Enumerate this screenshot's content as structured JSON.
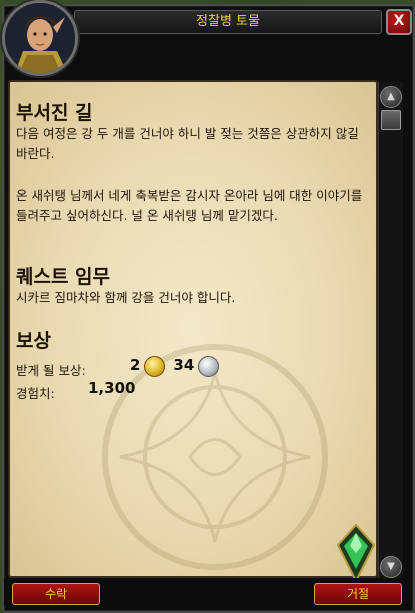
{
  "window": {
    "title": "정찰병 토물",
    "close_label": "X"
  },
  "quest": {
    "title": "부서진 길",
    "description_1": "다음 여정은 강 두 개를 건너야 하니 발 젖는 것쯤은 상관하지 않길 바란다.",
    "description_2": "온 새쉬탱 님께서 네게 축복받은 감시자 온아라 님에 대한 이야기를 들려주고 싶어하신다. 널 온 새쉬탱 님께 맡기겠다."
  },
  "objectives": {
    "heading": "퀘스트 임무",
    "text": "시카르 짐마차와 함께 강을 건너야 합니다."
  },
  "rewards": {
    "heading": "보상",
    "receive_label": "받게 될 보상:",
    "gold": "2",
    "silver": "34",
    "xp_label": "경험치:",
    "xp_value": "1,300"
  },
  "buttons": {
    "accept": "수락",
    "decline": "거절"
  },
  "scroll": {
    "up_glyph": "▲",
    "down_glyph": "▼"
  },
  "colors": {
    "title_text": "#f2d23c",
    "button_bg": "#b01414",
    "parchment": "#efe2bf"
  }
}
